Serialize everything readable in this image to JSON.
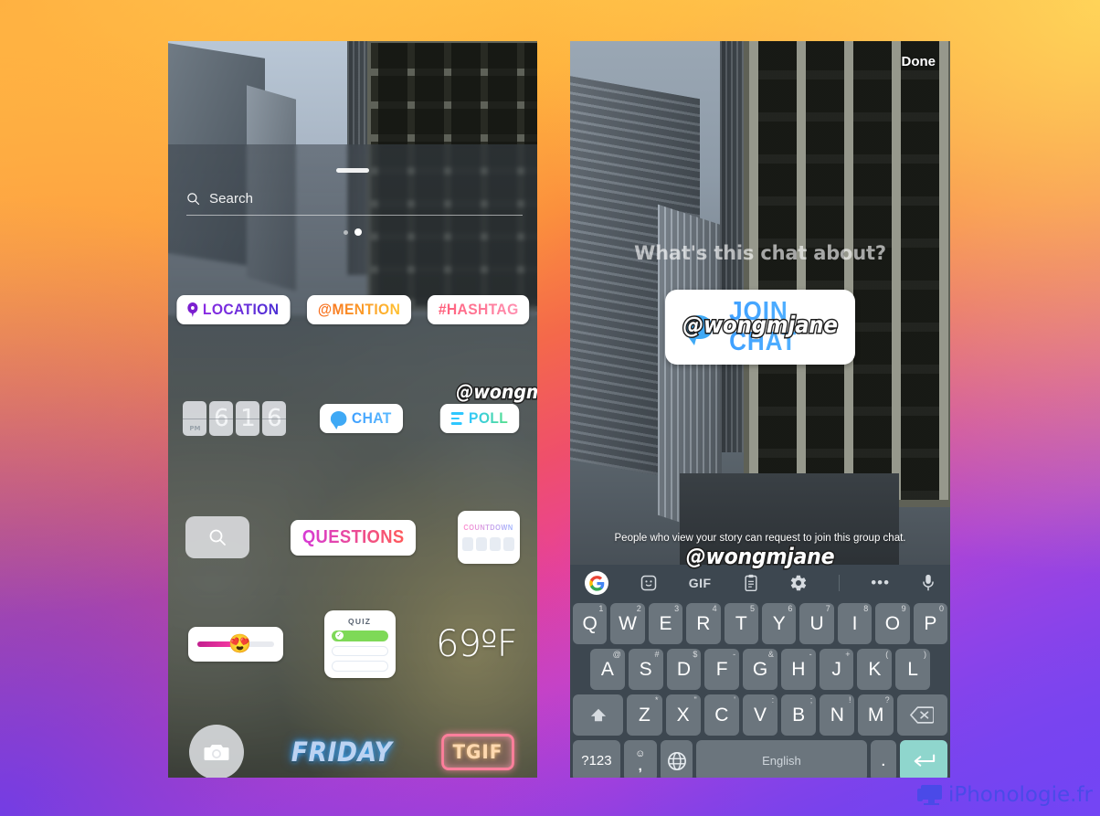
{
  "background": {
    "gradient_colors": [
      "#ffd95e",
      "#ffb43f",
      "#f4694a",
      "#e8419a",
      "#a93fd8",
      "#5a3ff0"
    ]
  },
  "left_phone": {
    "name": "instagram-sticker-tray",
    "grabber": "",
    "search": {
      "placeholder": "Search",
      "icon": "search-icon"
    },
    "page_dots": [
      "inactive",
      "active"
    ],
    "stickers": {
      "row1": [
        {
          "id": "location",
          "label": "LOCATION",
          "icon": "location-pin-icon",
          "color": "#7b1fd0"
        },
        {
          "id": "mention",
          "label": "@MENTION",
          "color": "#f76b1c"
        },
        {
          "id": "hashtag",
          "label": "#HASHTAG",
          "color": "#ff5e7a"
        }
      ],
      "row2": [
        {
          "id": "time",
          "label": "6 16",
          "ampm": "PM",
          "digits": [
            "6",
            "1",
            "6"
          ]
        },
        {
          "id": "chat",
          "label": "CHAT",
          "icon": "chat-bubble-icon",
          "color": "#3fa9f5",
          "overlay_handle": "@wongmjane"
        },
        {
          "id": "poll",
          "label": "POLL",
          "icon": "poll-bars-icon",
          "color": "#2ec7ff"
        }
      ],
      "row3": [
        {
          "id": "gif-search",
          "icon": "search-icon"
        },
        {
          "id": "questions",
          "label": "QUESTIONS",
          "color": "#d63bd6"
        },
        {
          "id": "countdown",
          "label": "COUNTDOWN",
          "color": "#ff8fd0"
        }
      ],
      "row4": [
        {
          "id": "emoji-slider",
          "emoji": "😍"
        },
        {
          "id": "quiz",
          "label": "QUIZ"
        },
        {
          "id": "temperature",
          "label": "69ºF"
        }
      ],
      "row5": [
        {
          "id": "camera",
          "icon": "camera-icon"
        },
        {
          "id": "friday",
          "label": "FRIDAY"
        },
        {
          "id": "tgif",
          "label": "TGIF"
        }
      ]
    }
  },
  "right_phone": {
    "name": "group-chat-sticker-editor",
    "done_label": "Done",
    "chat_prompt_placeholder": "What's this chat about?",
    "join_chat_label": "JOIN CHAT",
    "handle": "@wongmjane",
    "hint_text": "People who view your story can request to join this group chat.",
    "bottom_handle": "@wongmjane",
    "keyboard": {
      "toolbar": [
        {
          "id": "google",
          "icon": "google-logo-icon",
          "glyph": "G"
        },
        {
          "id": "sticker",
          "icon": "sticker-smiley-icon",
          "glyph": "☺"
        },
        {
          "id": "gif",
          "icon": "gif-icon",
          "glyph": "GIF"
        },
        {
          "id": "clipboard",
          "icon": "clipboard-icon",
          "glyph": "📋"
        },
        {
          "id": "settings",
          "icon": "gear-icon",
          "glyph": "⚙"
        },
        {
          "id": "more",
          "icon": "more-dots-icon",
          "glyph": "•••"
        },
        {
          "id": "mic",
          "icon": "microphone-icon",
          "glyph": "🎤"
        }
      ],
      "row1": [
        {
          "key": "Q",
          "hint": "1"
        },
        {
          "key": "W",
          "hint": "2"
        },
        {
          "key": "E",
          "hint": "3"
        },
        {
          "key": "R",
          "hint": "4"
        },
        {
          "key": "T",
          "hint": "5"
        },
        {
          "key": "Y",
          "hint": "6"
        },
        {
          "key": "U",
          "hint": "7"
        },
        {
          "key": "I",
          "hint": "8"
        },
        {
          "key": "O",
          "hint": "9"
        },
        {
          "key": "P",
          "hint": "0"
        }
      ],
      "row2": [
        {
          "key": "A",
          "hint": "@"
        },
        {
          "key": "S",
          "hint": "#"
        },
        {
          "key": "D",
          "hint": "$"
        },
        {
          "key": "F",
          "hint": "-"
        },
        {
          "key": "G",
          "hint": "&"
        },
        {
          "key": "H",
          "hint": "-"
        },
        {
          "key": "J",
          "hint": "+"
        },
        {
          "key": "K",
          "hint": "("
        },
        {
          "key": "L",
          "hint": ")"
        }
      ],
      "row3": [
        {
          "key": "Z",
          "hint": "*"
        },
        {
          "key": "X",
          "hint": "\""
        },
        {
          "key": "C",
          "hint": "'"
        },
        {
          "key": "V",
          "hint": ":"
        },
        {
          "key": "B",
          "hint": ";"
        },
        {
          "key": "N",
          "hint": "!"
        },
        {
          "key": "M",
          "hint": "?"
        }
      ],
      "shift_label": "⬆",
      "backspace_label": "⌫",
      "symbols_label": "?123",
      "emoji_top": "☺",
      "emoji_bottom": ",",
      "globe_label": "🌐",
      "space_label": "English",
      "period_label": ".",
      "enter_label": "↵"
    }
  },
  "watermark": {
    "text": "iPhonologie.fr",
    "icon": "monitor-icon",
    "color": "#4a4ae8"
  }
}
